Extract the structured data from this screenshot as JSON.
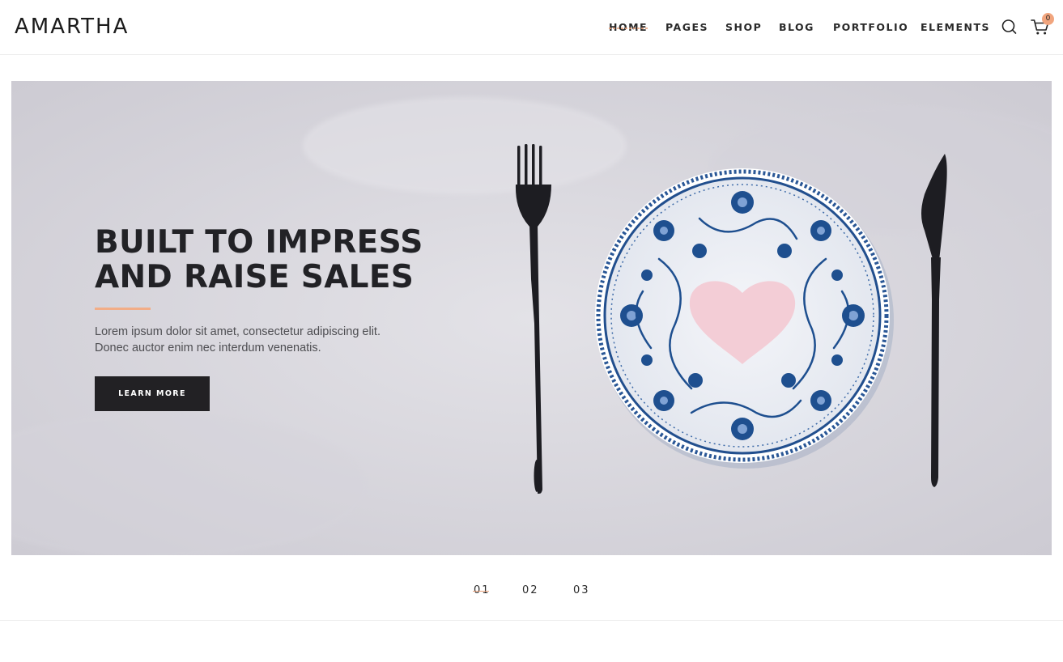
{
  "brand": {
    "logo_text": "AMARTHA"
  },
  "nav": {
    "items": [
      {
        "label": "HOME",
        "active": true
      },
      {
        "label": "PAGES"
      },
      {
        "label": "SHOP"
      },
      {
        "label": "BLOG"
      },
      {
        "label": "PORTFOLIO"
      },
      {
        "label": "ELEMENTS"
      }
    ]
  },
  "header_icons": {
    "search": "search-icon",
    "cart": "cart-icon",
    "cart_count": "0"
  },
  "hero": {
    "title_line1": "BUILT TO IMPRESS",
    "title_line2": "AND RAISE SALES",
    "text_line1": "Lorem ipsum dolor sit amet, consectetur adipiscing elit.",
    "text_line2": "Donec auctor enim nec interdum venenatis.",
    "button_label": "LEARN MORE"
  },
  "slider_pager": [
    {
      "label": "01",
      "active": true
    },
    {
      "label": "02"
    },
    {
      "label": "03"
    }
  ],
  "colors": {
    "accent": "#f2ad87",
    "dark": "#222124",
    "hero_bg": "#dcdbe0",
    "plate_blue": "#1e4f8f",
    "heart_pink": "#f3cdd6"
  }
}
